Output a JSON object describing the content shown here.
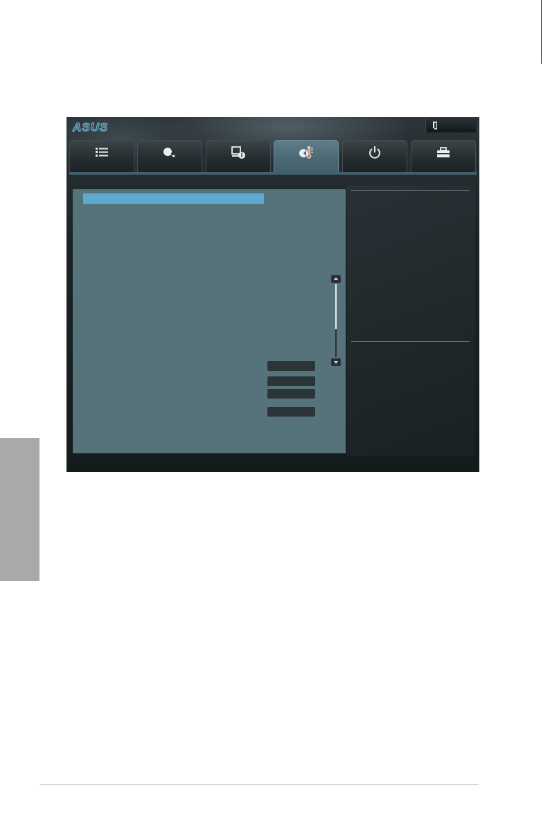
{
  "page": {
    "side_tab_color": "#a9a9a9",
    "footer_rule_color": "#c8c8c8"
  },
  "bios": {
    "brand_logo_text": "ASUS",
    "exit_button_icon": "exit-door-icon",
    "accent_color": "#5da9cf",
    "panel_color": "#56737c",
    "tabs": [
      {
        "name": "tab-main",
        "icon": "list-icon",
        "active": false
      },
      {
        "name": "tab-ai-tweaker",
        "icon": "tweaker-icon",
        "active": false
      },
      {
        "name": "tab-advanced",
        "icon": "advanced-info-icon",
        "active": false
      },
      {
        "name": "tab-monitor",
        "icon": "thermometer-fan-icon",
        "active": true
      },
      {
        "name": "tab-boot",
        "icon": "power-icon",
        "active": false
      },
      {
        "name": "tab-tool",
        "icon": "toolbox-icon",
        "active": false
      }
    ]
  }
}
